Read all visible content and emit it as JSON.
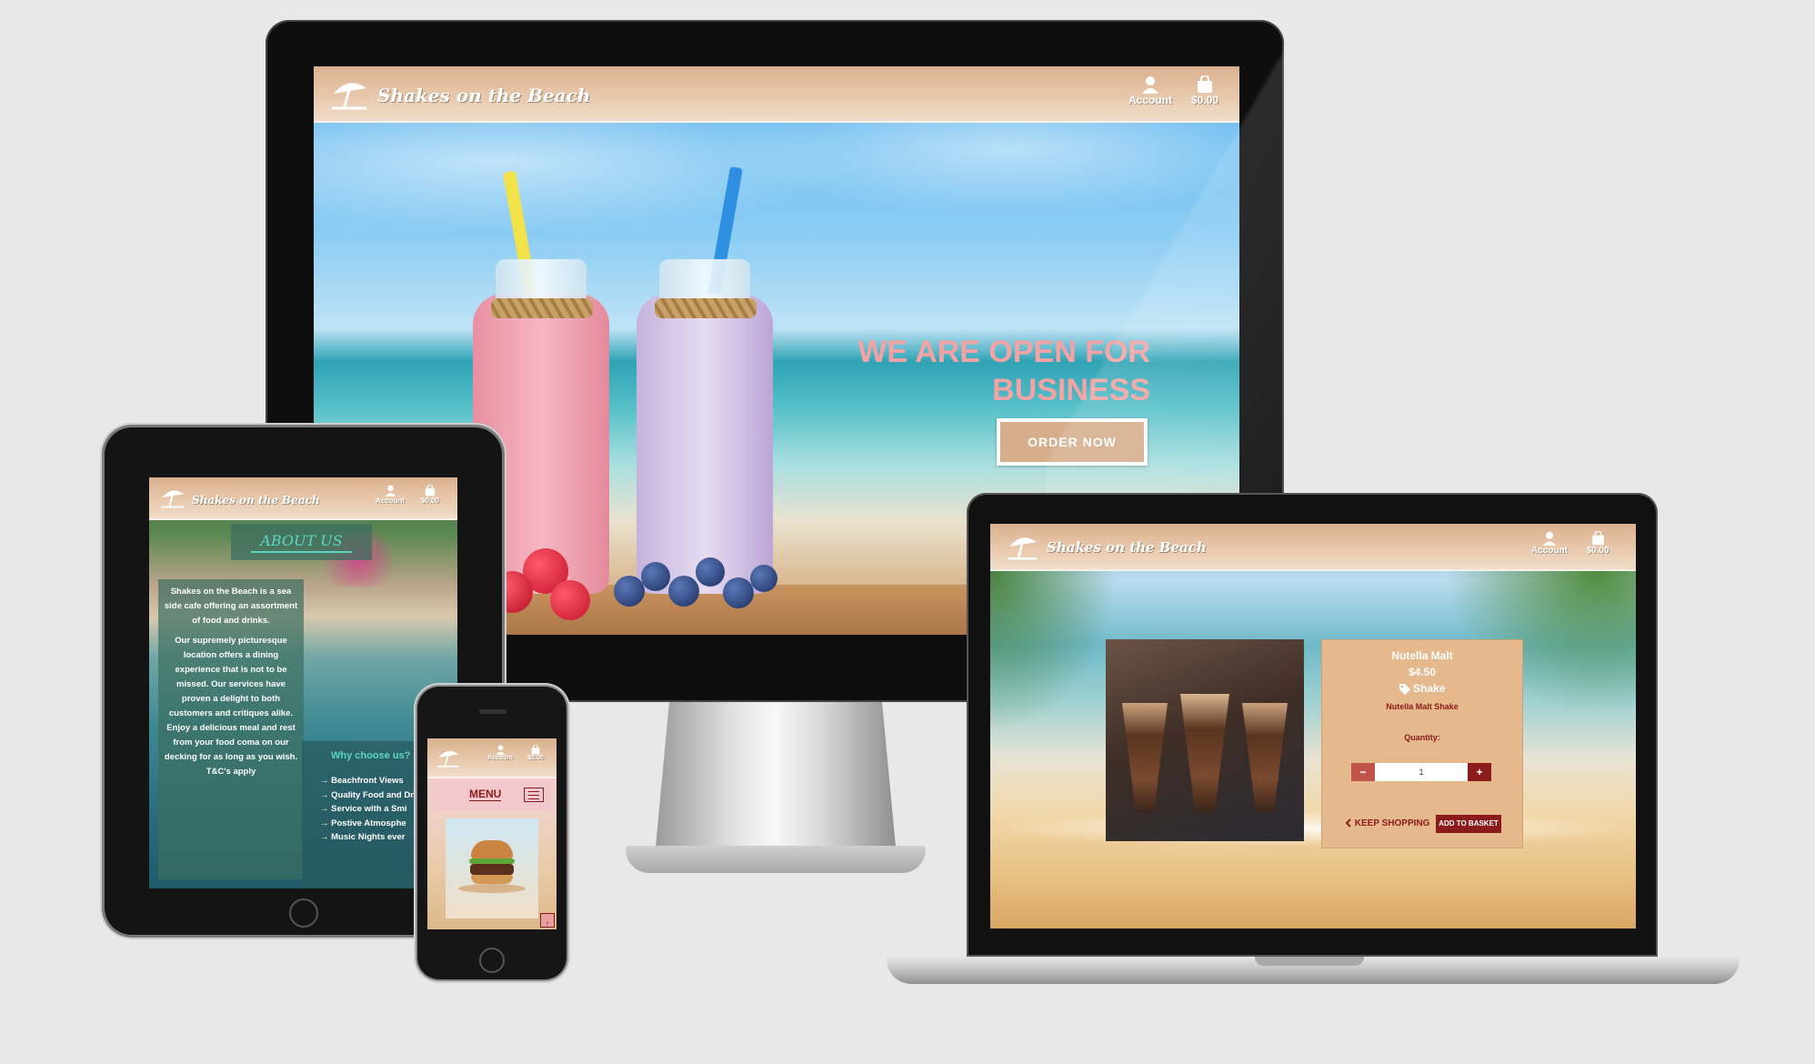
{
  "site": {
    "brand": "Shakes on the Beach",
    "account_label": "Account",
    "basket_total": "$0.00"
  },
  "desktop": {
    "hero_title_line1": "WE ARE OPEN FOR",
    "hero_title_line2": "BUSINESS",
    "order_button": "ORDER NOW"
  },
  "laptop": {
    "product": {
      "name": "Nutella Malt",
      "price": "$4.50",
      "category": "Shake",
      "description": "Nutella Malt Shake",
      "quantity_label": "Quantity:",
      "quantity_value": "1",
      "decrement": "−",
      "increment": "+"
    },
    "keep_shopping": "KEEP SHOPPING",
    "add_to_basket": "ADD TO BASKET"
  },
  "tablet": {
    "about_title": "ABOUT US",
    "about_p1": "Shakes on the Beach is a sea side cafe offering an assortment of food and drinks.",
    "about_p2": "Our supremely picturesque location offers a dining experience that is not to be missed. Our services have proven a delight to both customers and critiques alike. Enjoy a delicious meal and rest from your food coma on our decking for as long as you wish. T&C's apply",
    "why_title": "Why choose us?",
    "why_items": [
      "Beachfront Views",
      "Quality Food and Dr",
      "Service with a Smi",
      "Postive Atmosphe",
      "Music Nights ever"
    ]
  },
  "phone": {
    "menu_label": "MENU"
  },
  "colors": {
    "header_tan": "#e6c4a6",
    "hero_pink": "#f3a3a3",
    "button_tan": "#d6ae8c",
    "maroon": "#8b1a1a",
    "teal": "#5fd6c4"
  },
  "icons": [
    "umbrella-logo-icon",
    "user-icon",
    "shopping-bag-icon",
    "tag-icon",
    "chevron-left-icon",
    "hamburger-icon",
    "arrow-right-icon",
    "arrow-up-icon"
  ]
}
